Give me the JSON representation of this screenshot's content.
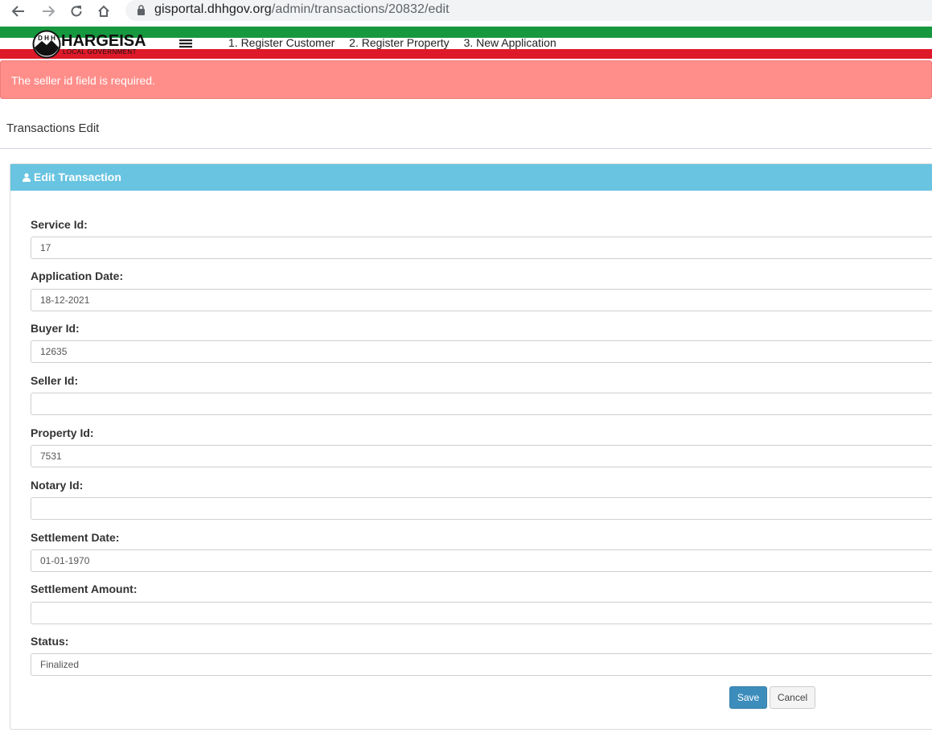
{
  "browser": {
    "url_host": "gisportal.dhhgov.org",
    "url_path": "/admin/transactions/20832/edit"
  },
  "header": {
    "logo_title": "HARGEISA",
    "logo_subtitle": "LOCAL GOVERNMENT",
    "logo_emblem_letters": "DHH",
    "nav": [
      {
        "label": "1. Register Customer"
      },
      {
        "label": "2. Register Property"
      },
      {
        "label": "3. New Application"
      }
    ]
  },
  "alert": {
    "message": "The seller id field is required."
  },
  "page": {
    "title": "Transactions Edit"
  },
  "panel": {
    "title": "Edit Transaction"
  },
  "form": {
    "fields": [
      {
        "label": "Service Id:",
        "value": "17"
      },
      {
        "label": "Application Date:",
        "value": "18-12-2021"
      },
      {
        "label": "Buyer Id:",
        "value": "12635"
      },
      {
        "label": "Seller Id:",
        "value": ""
      },
      {
        "label": "Property Id:",
        "value": "7531"
      },
      {
        "label": "Notary Id:",
        "value": ""
      },
      {
        "label": "Settlement Date:",
        "value": "01-01-1970"
      },
      {
        "label": "Settlement Amount:",
        "value": ""
      },
      {
        "label": "Status:",
        "value": "Finalized"
      }
    ],
    "save_label": "Save",
    "cancel_label": "Cancel"
  },
  "colors": {
    "flag_green": "#16983f",
    "flag_red": "#de1a2a",
    "alert_bg": "#ff8e8a",
    "panel_heading": "#68c4e0",
    "primary_button": "#3c8dbc"
  }
}
